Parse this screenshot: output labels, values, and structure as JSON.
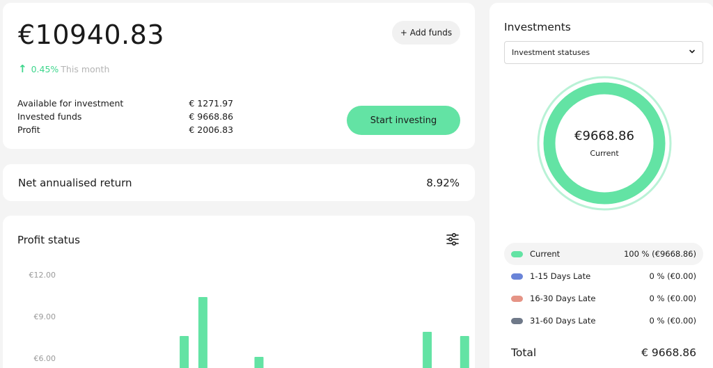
{
  "balance": {
    "amount": "€10940.83",
    "add_funds_label": "+ Add funds",
    "growth_pct": "0.45%",
    "growth_period": "This month",
    "stats": [
      {
        "label": "Available for investment",
        "value": "€ 1271.97"
      },
      {
        "label": "Invested funds",
        "value": "€ 9668.86"
      },
      {
        "label": "Profit",
        "value": "€ 2006.83"
      }
    ],
    "start_investing_label": "Start investing"
  },
  "net_return": {
    "label": "Net annualised return",
    "value": "8.92%"
  },
  "profit_status": {
    "title": "Profit status"
  },
  "chart_data": {
    "type": "bar",
    "y_ticks": [
      "€12.00",
      "€9.00",
      "€6.00"
    ],
    "y_tick_values": [
      12,
      9,
      6
    ],
    "values": [
      null,
      null,
      null,
      7.6,
      10.4,
      null,
      null,
      6.1,
      null,
      null,
      null,
      null,
      null,
      null,
      null,
      null,
      7.9,
      null,
      7.6
    ],
    "ylim": [
      0,
      14
    ],
    "color": "#63e3a4"
  },
  "investments": {
    "title": "Investments",
    "select_value": "Investment statuses",
    "donut_amount": "€9668.86",
    "donut_label": "Current",
    "donut_color": "#63e3a4",
    "legend": [
      {
        "label": "Current",
        "value": "100 % (€9668.86)",
        "color": "#63e3a4"
      },
      {
        "label": "1-15 Days Late",
        "value": "0 % (€0.00)",
        "color": "#6a84d8"
      },
      {
        "label": "16-30 Days Late",
        "value": "0 % (€0.00)",
        "color": "#e59486"
      },
      {
        "label": "31-60 Days Late",
        "value": "0 % (€0.00)",
        "color": "#6f7989"
      }
    ],
    "total_label": "Total",
    "total_value": "€ 9668.86"
  }
}
